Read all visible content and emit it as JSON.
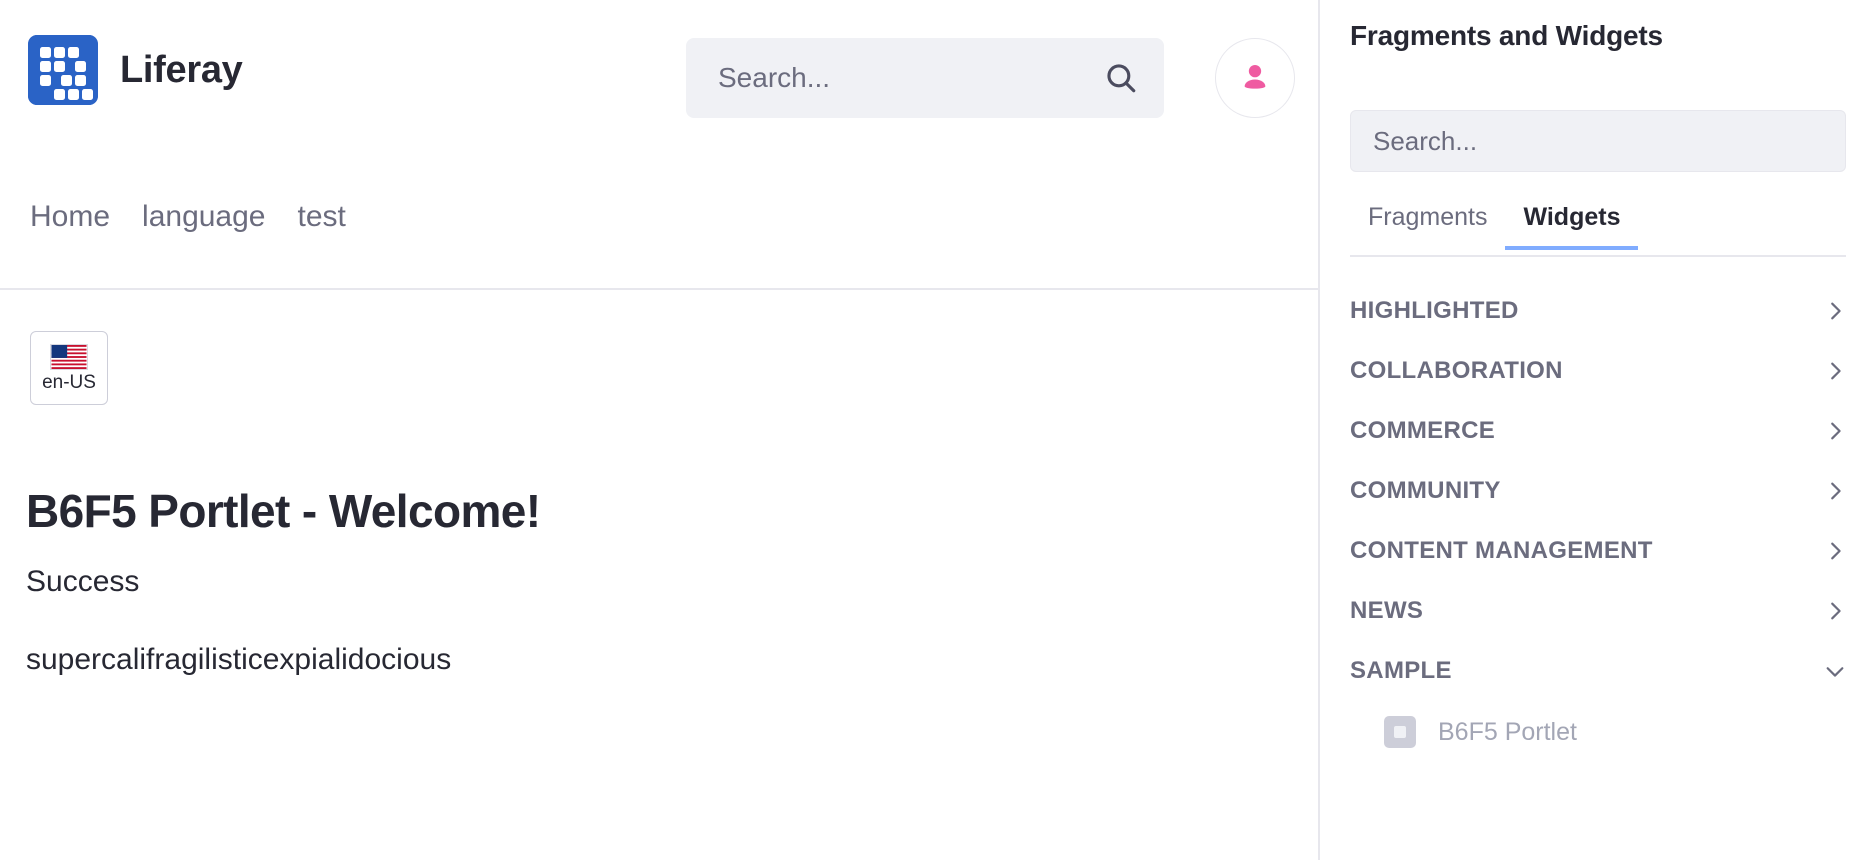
{
  "header": {
    "brand_name": "Liferay",
    "logo_icon": "liferay-logo-icon",
    "search": {
      "placeholder": "Search...",
      "value": "",
      "icon": "search-icon"
    },
    "avatar": {
      "icon": "user-icon",
      "color": "#ef5ba1"
    }
  },
  "nav": {
    "items": [
      {
        "label": "Home"
      },
      {
        "label": "language"
      },
      {
        "label": "test"
      }
    ]
  },
  "language_selector": {
    "label": "en-US",
    "flag_icon": "us-flag-icon"
  },
  "portlet": {
    "title": "B6F5 Portlet - Welcome!",
    "status": "Success",
    "message": "supercalifragilisticexpialidocious"
  },
  "sidebar": {
    "title": "Fragments and Widgets",
    "search": {
      "placeholder": "Search...",
      "value": ""
    },
    "tabs": [
      {
        "label": "Fragments",
        "active": false
      },
      {
        "label": "Widgets",
        "active": true
      }
    ],
    "active_tab_color": "#80acff",
    "categories": [
      {
        "label": "HIGHLIGHTED",
        "expanded": false,
        "chevron": "chevron-right-icon"
      },
      {
        "label": "COLLABORATION",
        "expanded": false,
        "chevron": "chevron-right-icon"
      },
      {
        "label": "COMMERCE",
        "expanded": false,
        "chevron": "chevron-right-icon"
      },
      {
        "label": "COMMUNITY",
        "expanded": false,
        "chevron": "chevron-right-icon"
      },
      {
        "label": "CONTENT MANAGEMENT",
        "expanded": false,
        "chevron": "chevron-right-icon"
      },
      {
        "label": "NEWS",
        "expanded": false,
        "chevron": "chevron-right-icon"
      },
      {
        "label": "SAMPLE",
        "expanded": true,
        "chevron": "chevron-down-icon"
      }
    ],
    "widgets": [
      {
        "label": "B6F5 Portlet",
        "icon": "widget-icon"
      }
    ]
  },
  "colors": {
    "brand_blue": "#2a63c6",
    "accent_pink": "#ef5ba1",
    "text_dark": "#272833",
    "text_muted": "#6b6c7e",
    "border": "#e7e7ed",
    "field_bg": "#f0f1f5"
  }
}
